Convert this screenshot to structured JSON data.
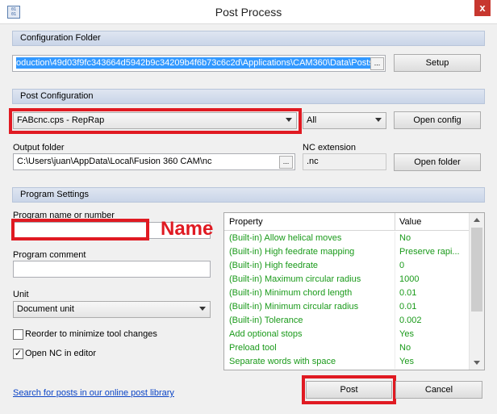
{
  "window": {
    "title": "Post Process",
    "icon_text": "01 01",
    "close_glyph": "x"
  },
  "config_folder": {
    "header": "Configuration Folder",
    "path_value": "oduction\\49d03f9fc343664d5942b9c34209b4f6b73c6c2d\\Applications\\CAM360\\Data\\Posts",
    "browse_label": "...",
    "setup_label": "Setup"
  },
  "post_config": {
    "header": "Post Configuration",
    "post_selected": "FABcnc.cps - RepRap",
    "filter_selected": "All",
    "open_config_label": "Open config",
    "output_folder_label": "Output folder",
    "output_folder_value": "C:\\Users\\juan\\AppData\\Local\\Fusion 360 CAM\\nc",
    "browse_label": "...",
    "nc_extension_label": "NC extension",
    "nc_extension_value": ".nc",
    "open_folder_label": "Open folder"
  },
  "program_settings": {
    "header": "Program Settings",
    "program_name_label": "Program name or number",
    "program_name_value": "",
    "annotation_text": "Name",
    "program_comment_label": "Program comment",
    "program_comment_value": "",
    "unit_label": "Unit",
    "unit_selected": "Document unit",
    "reorder_label": "Reorder to minimize tool changes",
    "reorder_checked": false,
    "open_nc_label": "Open NC in editor",
    "open_nc_checked": true,
    "check_mark": "✓"
  },
  "properties": {
    "col_property": "Property",
    "col_value": "Value",
    "rows": [
      {
        "name": "(Built-in) Allow helical moves",
        "value": "No"
      },
      {
        "name": "(Built-in) High feedrate mapping",
        "value": "Preserve rapi..."
      },
      {
        "name": "(Built-in) High feedrate",
        "value": "0"
      },
      {
        "name": "(Built-in) Maximum circular radius",
        "value": "1000"
      },
      {
        "name": "(Built-in) Minimum chord length",
        "value": "0.01"
      },
      {
        "name": "(Built-in) Minimum circular radius",
        "value": "0.01"
      },
      {
        "name": "(Built-in) Tolerance",
        "value": "0.002"
      },
      {
        "name": "Add optional stops",
        "value": "Yes"
      },
      {
        "name": "Preload tool",
        "value": "No"
      },
      {
        "name": "Separate words with space",
        "value": "Yes"
      }
    ]
  },
  "footer": {
    "library_link": "Search for posts in our online post library",
    "post_label": "Post",
    "cancel_label": "Cancel"
  },
  "colors": {
    "annotation_red": "#e01a22",
    "property_green": "#1a9a1a",
    "selection_blue": "#3399ff",
    "link_blue": "#0b44c6"
  }
}
